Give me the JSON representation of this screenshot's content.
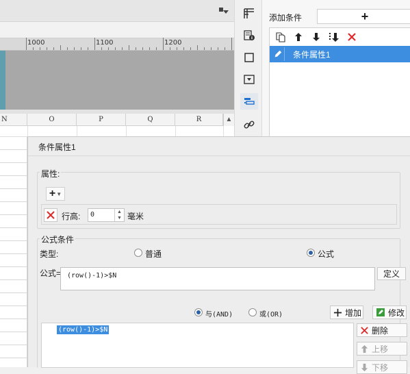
{
  "designer": {
    "ruler_ticks": [
      "1000",
      "1100",
      "1200"
    ],
    "columns": [
      "N",
      "O",
      "P",
      "Q",
      "R"
    ]
  },
  "side_tabs": [
    {
      "name": "cell-layout-icon",
      "active": false
    },
    {
      "name": "cell-properties-icon",
      "active": false
    },
    {
      "name": "border-icon",
      "active": false
    },
    {
      "name": "widget-icon",
      "active": false
    },
    {
      "name": "condition-attributes-icon",
      "active": true
    },
    {
      "name": "hyperlink-icon",
      "active": false
    }
  ],
  "right_panel": {
    "add_condition_label": "添加条件",
    "add_button_label": "+",
    "toolbar": [
      "copy-icon",
      "move-up-icon",
      "move-down-icon",
      "move-bottom-icon",
      "delete-icon"
    ],
    "items": [
      "条件属性1"
    ]
  },
  "dialog": {
    "title": "条件属性1",
    "attributes_group": {
      "label": "属性:",
      "add_button": "+",
      "row_height_label": "行高:",
      "row_height_value": "0",
      "unit": "毫米"
    },
    "formula_group": {
      "label": "公式条件",
      "type_label": "类型:",
      "type_options": [
        {
          "label": "普通",
          "selected": false
        },
        {
          "label": "公式",
          "selected": true
        }
      ],
      "formula_label": "公式=",
      "formula_value": "(row()-1)>$N",
      "define_button": "定义",
      "logic_options": [
        {
          "label": "与(AND)",
          "selected": true
        },
        {
          "label": "或(OR)",
          "selected": false
        }
      ],
      "add_button": "增加",
      "modify_button": "修改",
      "delete_button": "删除",
      "move_up_button": "上移",
      "move_down_button": "下移",
      "condition_list": [
        "(row()-1)>$N"
      ]
    }
  },
  "colors": {
    "selection_blue": "#3d8ee0",
    "delete_red": "#e02a2a",
    "modify_green": "#3a9c3a"
  }
}
